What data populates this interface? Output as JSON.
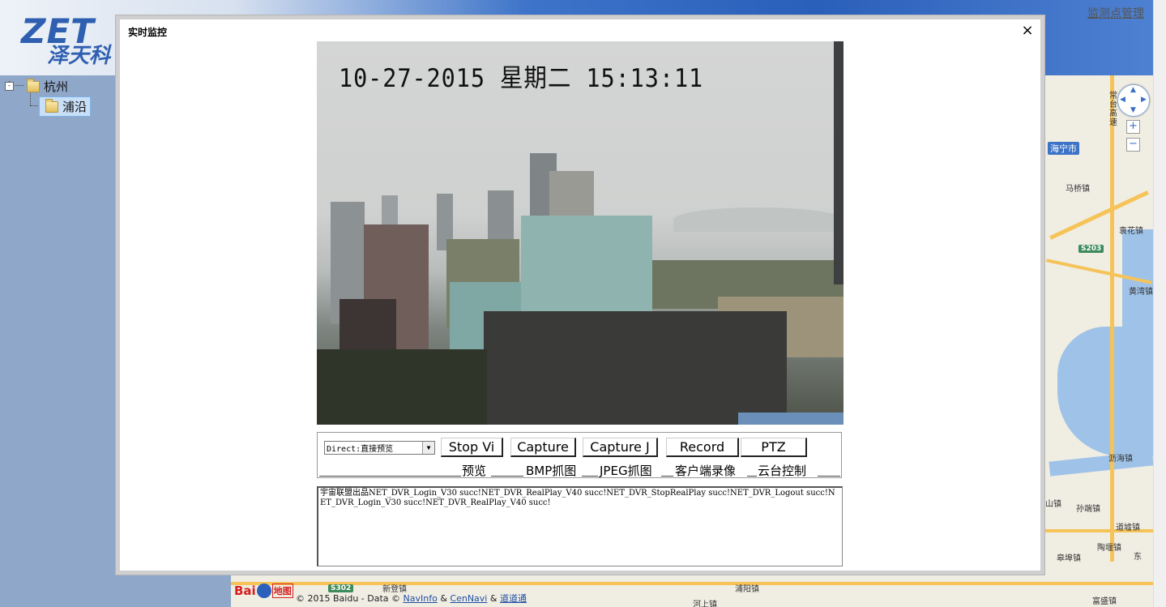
{
  "header": {
    "logo_latin": "ZET",
    "logo_chinese": "泽天科",
    "top_right_link": "监测点管理"
  },
  "sidebar": {
    "tree": [
      {
        "label": "杭州",
        "expanded": true
      },
      {
        "label": "浦沿",
        "selected": true
      }
    ]
  },
  "map": {
    "labels": [
      "常台高速",
      "海宁市",
      "马桥镇",
      "袁花镇",
      "黄湾镇",
      "沥海镇",
      "孙端镇",
      "道墟镇",
      "陶堰镇",
      "皋埠镇",
      "富盛镇",
      "新登镇",
      "浦阳镇",
      "河上镇",
      "山镇",
      "东"
    ],
    "shields": [
      "S203",
      "S302"
    ],
    "copyright": "© 2015 Baidu - Data © ",
    "copyright_links": [
      "NavInfo",
      "CenNavi",
      "道道通"
    ],
    "copyright_amp": "&",
    "baidu_logo": "Bai",
    "baidu_logo_suffix": "地图",
    "zoom_in": "+",
    "zoom_out": "−"
  },
  "dialog": {
    "title": "实时监控",
    "close_label": "×"
  },
  "video": {
    "osd_text": "10-27-2015 星期二 15:13:11"
  },
  "controls": {
    "mode_select_value": "Direct:直接预览",
    "buttons": [
      {
        "label": "Stop Vi",
        "caption": "预览"
      },
      {
        "label": "Capture",
        "caption": "BMP抓图"
      },
      {
        "label": "Capture J",
        "caption": "JPEG抓图"
      },
      {
        "label": "Record",
        "caption": "客户端录像"
      },
      {
        "label": "PTZ",
        "caption": "云台控制"
      }
    ]
  },
  "log": {
    "text": "宇宙联盟出品NET_DVR_Login_V30 succ!NET_DVR_RealPlay_V40 succ!NET_DVR_StopRealPlay succ!NET_DVR_Logout succ!NET_DVR_Login_V30 succ!NET_DVR_RealPlay_V40 succ!"
  },
  "colors": {
    "header_blue": "#2a5fba",
    "sidebar": "#8fa7c9",
    "map_water": "#9fc3e8",
    "map_road": "#f5c358"
  }
}
